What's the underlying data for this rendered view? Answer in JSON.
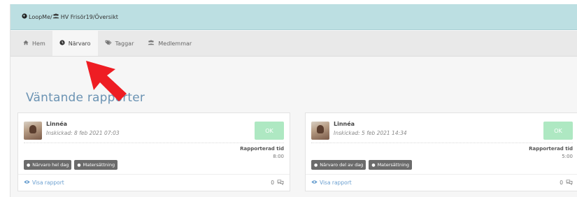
{
  "breadcrumb": {
    "items": [
      {
        "icon": "globe-icon",
        "label": "LoopMe"
      },
      {
        "icon": "group-icon",
        "label": "HV Frisör19"
      },
      {
        "icon": "",
        "label": "Översikt"
      }
    ]
  },
  "nav": {
    "tabs": [
      {
        "icon": "home-icon",
        "label": "Hem",
        "active": false
      },
      {
        "icon": "clock-icon",
        "label": "Närvaro",
        "active": true
      },
      {
        "icon": "tags-icon",
        "label": "Taggar",
        "active": false
      },
      {
        "icon": "group-icon",
        "label": "Medlemmar",
        "active": false
      }
    ]
  },
  "annotation": {
    "arrow_color": "#ee1d23"
  },
  "main": {
    "section_title": "Väntande rapporter",
    "cards": [
      {
        "name": "Linnéa",
        "submitted": "Inskickad: 8 feb 2021 07:03",
        "ok_label": "OK",
        "reported_label": "Rapporterad tid",
        "reported_value": "8:00",
        "tags": [
          "Närvaro hel dag",
          "Matersättning"
        ],
        "view_label": "Visa rapport",
        "comment_count": "0"
      },
      {
        "name": "Linnéa",
        "submitted": "Inskickad: 5 feb 2021 14:34",
        "ok_label": "OK",
        "reported_label": "Rapporterad tid",
        "reported_value": "5:00",
        "tags": [
          "Närvaro del av dag",
          "Matersättning"
        ],
        "view_label": "Visa rapport",
        "comment_count": "0"
      }
    ]
  },
  "colors": {
    "topbar": "#bcdfe2",
    "navbar": "#e9e9e9",
    "title": "#6b93b3",
    "ok_button": "#aee8c2",
    "tag": "#6b6b6b",
    "link": "#6a9fd0"
  }
}
